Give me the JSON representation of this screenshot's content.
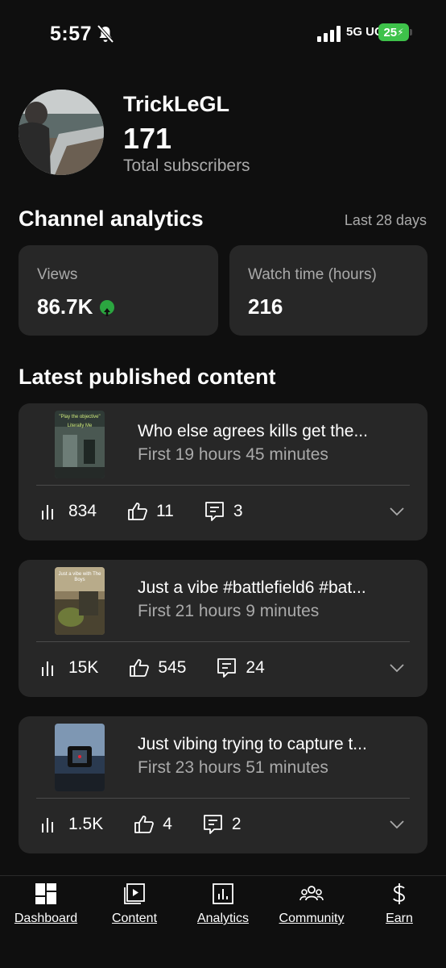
{
  "status": {
    "time": "5:57",
    "network": "5G UC",
    "battery": "25"
  },
  "channel": {
    "name": "TrickLeGL",
    "subscribers": "171",
    "subscribers_label": "Total subscribers"
  },
  "analytics": {
    "title": "Channel analytics",
    "period": "Last 28 days",
    "views_label": "Views",
    "views_value": "86.7K",
    "watch_label": "Watch time (hours)",
    "watch_value": "216"
  },
  "latest": {
    "title": "Latest published content",
    "items": [
      {
        "title": "Who else agrees kills get the...",
        "subtitle": "First 19 hours 45 minutes",
        "views": "834",
        "likes": "11",
        "comments": "3",
        "thumb_text": "\"Play the objective\"",
        "thumb_sub": "Literally Me"
      },
      {
        "title": "Just a vibe #battlefield6 #bat...",
        "subtitle": "First 21 hours 9 minutes",
        "views": "15K",
        "likes": "545",
        "comments": "24",
        "thumb_text": "Just a vibe with The Boys"
      },
      {
        "title": "Just vibing trying to capture t...",
        "subtitle": "First 23 hours 51 minutes",
        "views": "1.5K",
        "likes": "4",
        "comments": "2"
      }
    ]
  },
  "nav": [
    {
      "label": "Dashboard",
      "icon": "dashboard-icon"
    },
    {
      "label": "Content",
      "icon": "content-icon"
    },
    {
      "label": "Analytics",
      "icon": "analytics-icon"
    },
    {
      "label": "Community",
      "icon": "community-icon"
    },
    {
      "label": "Earn",
      "icon": "earn-icon"
    }
  ],
  "colors": {
    "background": "#0f0f0f",
    "card": "#272727",
    "muted": "#aaaaaa",
    "accent_green": "#2ba640",
    "battery": "#3ec24a"
  }
}
